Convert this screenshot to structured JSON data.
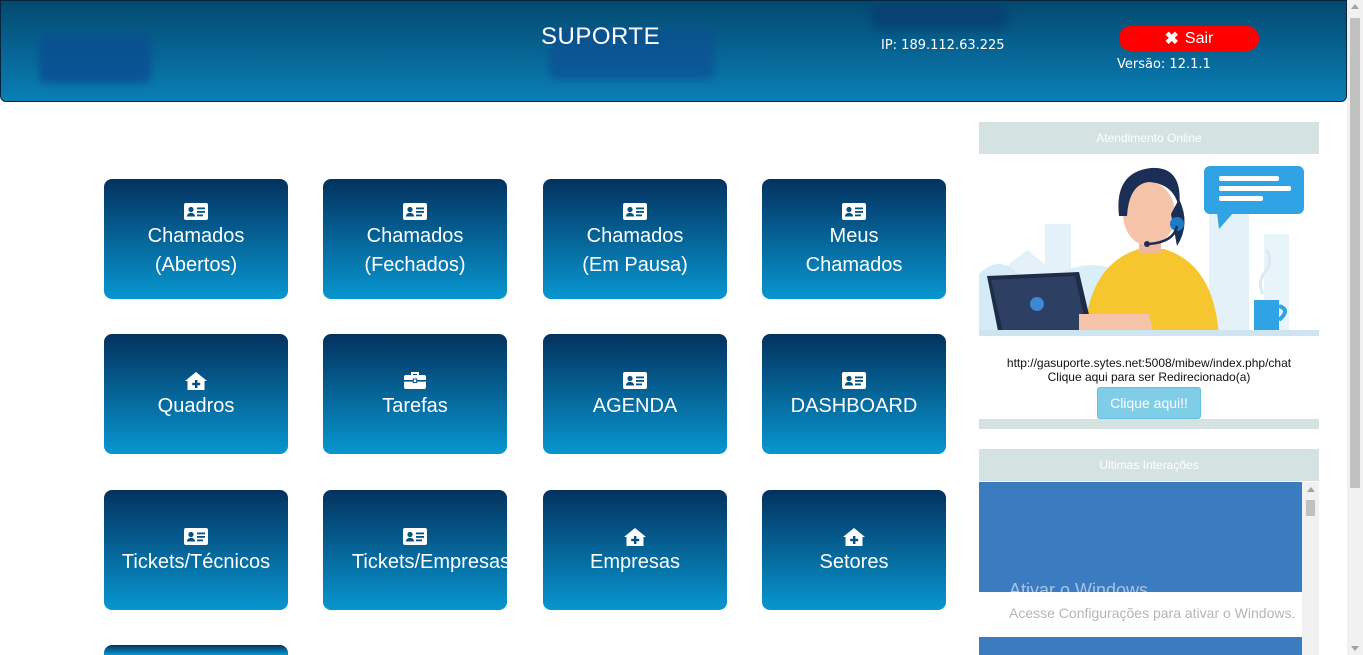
{
  "header": {
    "title": "SUPORTE",
    "ip": "IP: 189.112.63.225",
    "logout_label": "Sair",
    "version": "Versão: 12.1.1"
  },
  "tiles": [
    {
      "line1": "Chamados",
      "line2": "(Abertos)",
      "icon": "id-card-icon"
    },
    {
      "line1": "Chamados",
      "line2": "(Fechados)",
      "icon": "id-card-icon"
    },
    {
      "line1": "Chamados",
      "line2": "(Em Pausa)",
      "icon": "id-card-icon"
    },
    {
      "line1": "Meus",
      "line2": "Chamados",
      "icon": "id-card-icon"
    },
    {
      "line1": "Quadros",
      "line2": "",
      "icon": "house-plus-icon"
    },
    {
      "line1": "Tarefas",
      "line2": "",
      "icon": "briefcase-icon"
    },
    {
      "line1": "AGENDA",
      "line2": "",
      "icon": "id-card-icon"
    },
    {
      "line1": "DASHBOARD",
      "line2": "",
      "icon": "id-card-icon"
    },
    {
      "line1": "Tickets/Técnicos",
      "line2": "",
      "icon": "id-card-icon"
    },
    {
      "line1": "Tickets/Empresas",
      "line2": "",
      "icon": "id-card-icon"
    },
    {
      "line1": "Empresas",
      "line2": "",
      "icon": "house-plus-icon"
    },
    {
      "line1": "Setores",
      "line2": "",
      "icon": "house-plus-icon"
    }
  ],
  "online": {
    "heading": "Atendimento Online",
    "url": "http://gasuporte.sytes.net:5008/mibew/index.php/chat",
    "redirect_text": "Clique aqui para ser Redirecionado(a)",
    "button_label": "Clique aqui!!"
  },
  "interactions": {
    "heading": "Ultimas Interações"
  },
  "watermark": {
    "line1": "Ativar o Windows",
    "line2": "Acesse Configurações para ativar o Windows."
  },
  "colors": {
    "header_top": "#04496f",
    "header_bottom": "#0a7fb6",
    "tile_top": "#03325f",
    "tile_bottom": "#0896cf",
    "logout": "#ff0000",
    "panel_head": "#d4e2e2"
  }
}
